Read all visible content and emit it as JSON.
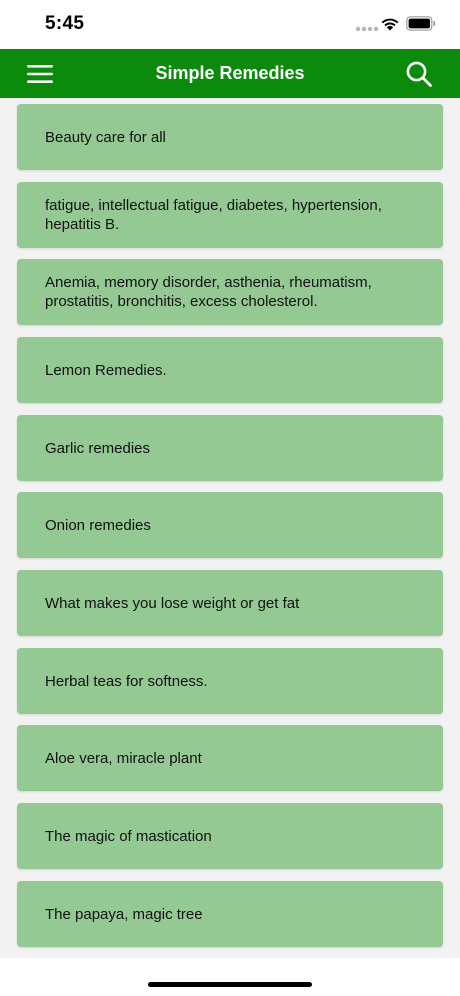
{
  "status_bar": {
    "time": "5:45"
  },
  "app_bar": {
    "title": "Simple Remedies",
    "menu_icon": "hamburger-menu-icon",
    "search_icon": "search-icon",
    "background": "#0b8a0b"
  },
  "list": {
    "item_color": "#94c994",
    "background": "#f2f2f2",
    "items": [
      {
        "label": "Beauty care for all"
      },
      {
        "label": "fatigue, intellectual fatigue, diabetes, hypertension, hepatitis B."
      },
      {
        "label": "Anemia, memory disorder, asthenia, rheumatism, prostatitis, bronchitis, excess cholesterol."
      },
      {
        "label": "Lemon Remedies."
      },
      {
        "label": "Garlic remedies"
      },
      {
        "label": "Onion remedies"
      },
      {
        "label": "What makes you lose weight or get fat"
      },
      {
        "label": "Herbal teas for softness."
      },
      {
        "label": "Aloe vera, miracle plant"
      },
      {
        "label": "The magic of mastication"
      },
      {
        "label": "The papaya, magic tree"
      }
    ]
  }
}
